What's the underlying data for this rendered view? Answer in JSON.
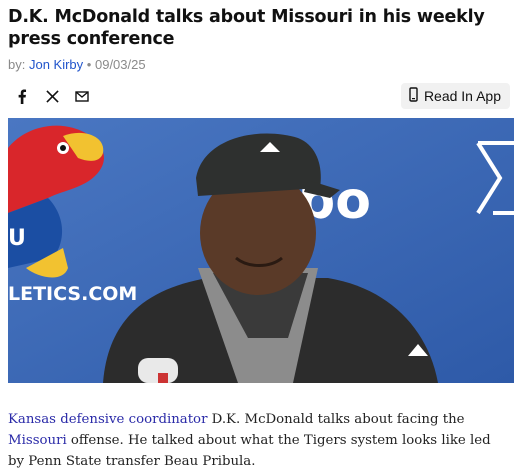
{
  "article": {
    "title": "D.K. McDonald talks about Missouri in his weekly press conference",
    "by_prefix": "by:",
    "author": "Jon Kirby",
    "separator": "•",
    "date": "09/03/25"
  },
  "share": {
    "icons": [
      "facebook-icon",
      "x-twitter-icon",
      "email-icon"
    ]
  },
  "read_app": {
    "label": "Read In App",
    "icon": "phone-icon"
  },
  "hero": {
    "backdrop_text_1": "bo",
    "backdrop_text_2": "LETICS.COM",
    "colors": {
      "backdrop": "#3b67b5",
      "red": "#d9262b",
      "gold": "#f2c230"
    }
  },
  "caption": {
    "link1": "Kansas defensive coordinator",
    "text1": " D.K. McDonald talks about facing the ",
    "link2": "Missouri",
    "text2": " offense. He talked about what the Tigers system looks like led by Penn State transfer Beau Pribula."
  }
}
